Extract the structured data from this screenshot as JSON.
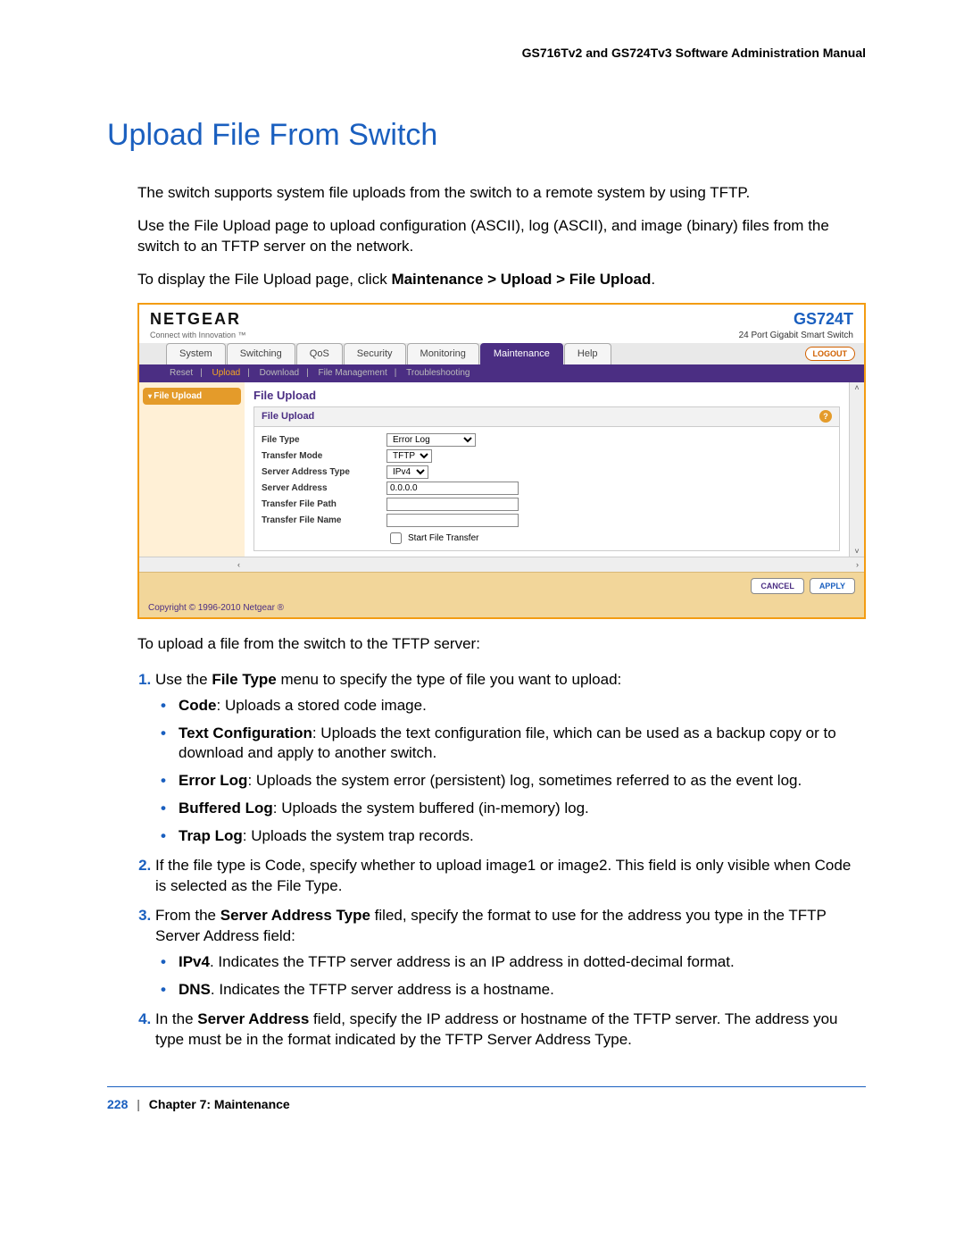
{
  "header": {
    "manual_title": "GS716Tv2 and GS724Tv3 Software Administration Manual"
  },
  "section": {
    "title": "Upload File From Switch",
    "p1": "The switch supports system file uploads from the switch to a remote system by using TFTP.",
    "p2": "Use the File Upload page to upload configuration (ASCII), log (ASCII), and image (binary) files from the switch to an TFTP server on the network.",
    "p3_pre": "To display the File Upload page, click ",
    "p3_path": "Maintenance > Upload > File Upload",
    "p3_post": "."
  },
  "screenshot": {
    "brand": "NETGEAR",
    "tagline": "Connect with Innovation ™",
    "model": "GS724T",
    "model_desc": "24 Port Gigabit Smart Switch",
    "tabs": [
      "System",
      "Switching",
      "QoS",
      "Security",
      "Monitoring",
      "Maintenance",
      "Help"
    ],
    "active_tab": "Maintenance",
    "logout": "LOGOUT",
    "subnav": {
      "items": [
        "Reset",
        "Upload",
        "Download",
        "File Management",
        "Troubleshooting"
      ],
      "active": "Upload"
    },
    "sidebar": {
      "item": "File Upload"
    },
    "panel": {
      "title": "File Upload",
      "sub": "File Upload",
      "fields": {
        "file_type_label": "File Type",
        "file_type_value": "Error Log",
        "transfer_mode_label": "Transfer Mode",
        "transfer_mode_value": "TFTP",
        "addr_type_label": "Server Address Type",
        "addr_type_value": "IPv4",
        "server_addr_label": "Server Address",
        "server_addr_value": "0.0.0.0",
        "file_path_label": "Transfer File Path",
        "file_path_value": "",
        "file_name_label": "Transfer File Name",
        "file_name_value": "",
        "start_label": "Start File Transfer"
      }
    },
    "buttons": {
      "cancel": "CANCEL",
      "apply": "APPLY"
    },
    "copyright": "Copyright © 1996-2010 Netgear ®"
  },
  "instructions": {
    "intro": "To upload a file from the switch to the TFTP server:",
    "li1_pre": "Use the ",
    "li1_b": "File Type",
    "li1_post": " menu to specify the type of file you want to upload:",
    "sa": {
      "b": "Code",
      "t": ": Uploads a stored code image."
    },
    "sb": {
      "b": "Text Configuration",
      "t": ": Uploads the text configuration file, which can be used as a backup copy or to download and apply to another switch."
    },
    "sc": {
      "b": "Error Log",
      "t": ": Uploads the system error (persistent) log, sometimes referred to as the event log."
    },
    "sd": {
      "b": "Buffered Log",
      "t": ": Uploads the system buffered (in-memory) log."
    },
    "se": {
      "b": "Trap Log",
      "t": ": Uploads the system trap records."
    },
    "li2": "If the file type is Code, specify whether to upload image1 or image2. This field is only visible when Code is selected as the File Type.",
    "li3_pre": "From the ",
    "li3_b": "Server Address Type",
    "li3_post": " filed, specify the format to use for the address you type in the TFTP Server Address field:",
    "s3a": {
      "b": "IPv4",
      "t": ". Indicates the TFTP server address is an IP address in dotted-decimal format."
    },
    "s3b": {
      "b": "DNS",
      "t": ". Indicates the TFTP server address is a hostname."
    },
    "li4_pre": "In the ",
    "li4_b": "Server Address",
    "li4_post": " field, specify the IP address or hostname of the TFTP server. The address you type must be in the format indicated by the TFTP Server Address Type."
  },
  "footer": {
    "page": "228",
    "chapter": "Chapter 7:  Maintenance"
  }
}
